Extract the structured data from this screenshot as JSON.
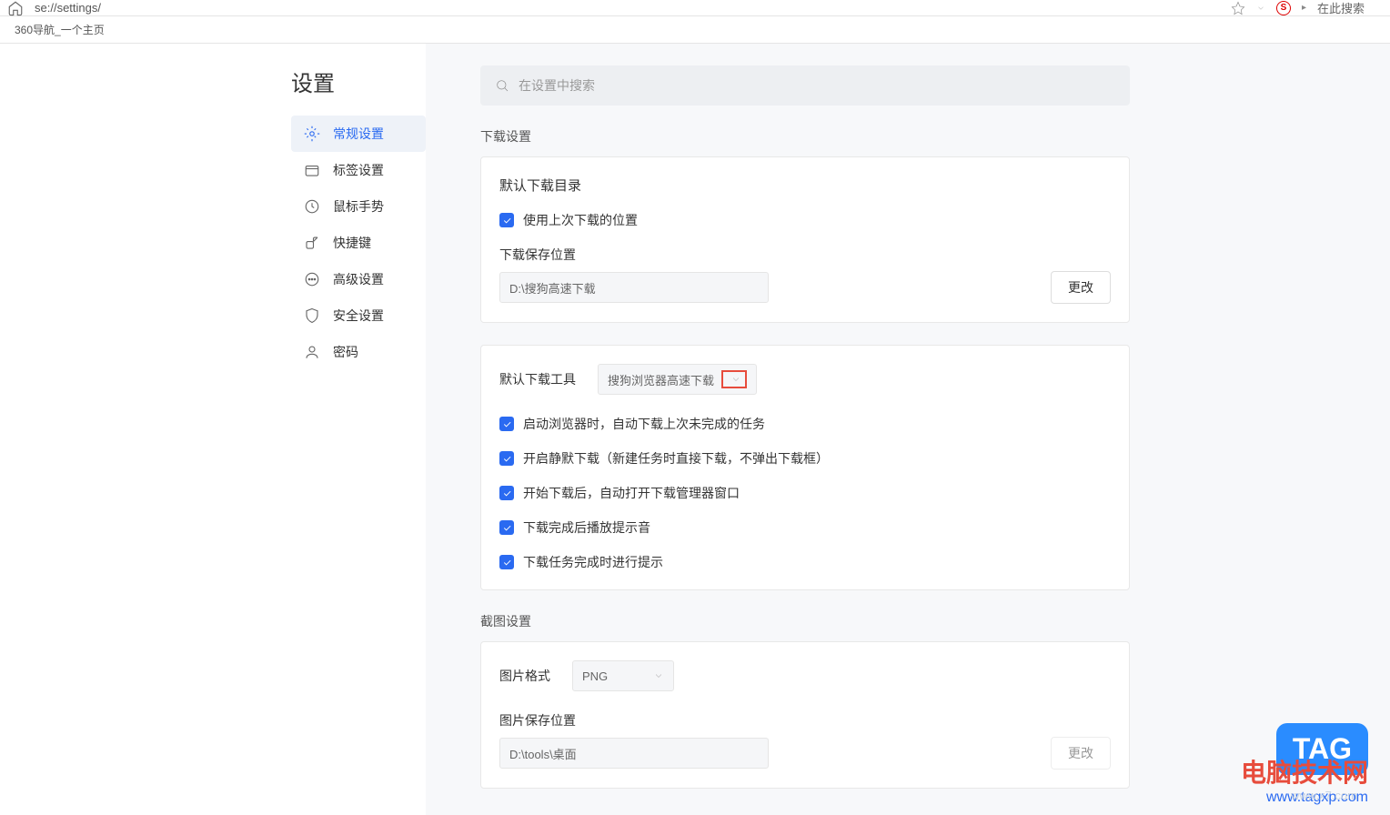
{
  "browser": {
    "url": "se://settings/",
    "search_hint": "在此搜索",
    "tab_label": "360导航_一个主页"
  },
  "page": {
    "title": "设置",
    "search_placeholder": "在设置中搜索"
  },
  "sidebar": {
    "items": [
      {
        "label": "常规设置",
        "icon": "gear"
      },
      {
        "label": "标签设置",
        "icon": "tab"
      },
      {
        "label": "鼠标手势",
        "icon": "clock"
      },
      {
        "label": "快捷键",
        "icon": "shortcut"
      },
      {
        "label": "高级设置",
        "icon": "dots"
      },
      {
        "label": "安全设置",
        "icon": "shield"
      },
      {
        "label": "密码",
        "icon": "user"
      }
    ]
  },
  "download": {
    "section_title": "下载设置",
    "default_dir_title": "默认下载目录",
    "use_last_location_label": "使用上次下载的位置",
    "save_location_label": "下载保存位置",
    "save_location_path": "D:\\搜狗高速下载",
    "change_btn": "更改",
    "default_tool_label": "默认下载工具",
    "default_tool_value": "搜狗浏览器高速下载",
    "options": [
      "启动浏览器时，自动下载上次未完成的任务",
      "开启静默下载（新建任务时直接下载，不弹出下载框）",
      "开始下载后，自动打开下载管理器窗口",
      "下载完成后播放提示音",
      "下载任务完成时进行提示"
    ]
  },
  "screenshot": {
    "section_title": "截图设置",
    "format_label": "图片格式",
    "format_value": "PNG",
    "save_location_label": "图片保存位置",
    "save_location_path": "D:\\tools\\桌面",
    "change_btn": "更改"
  },
  "watermark": {
    "title": "电脑技术网",
    "url": "www.tagxp.com",
    "tag": "TAG",
    "x7": "www.x7.com"
  }
}
